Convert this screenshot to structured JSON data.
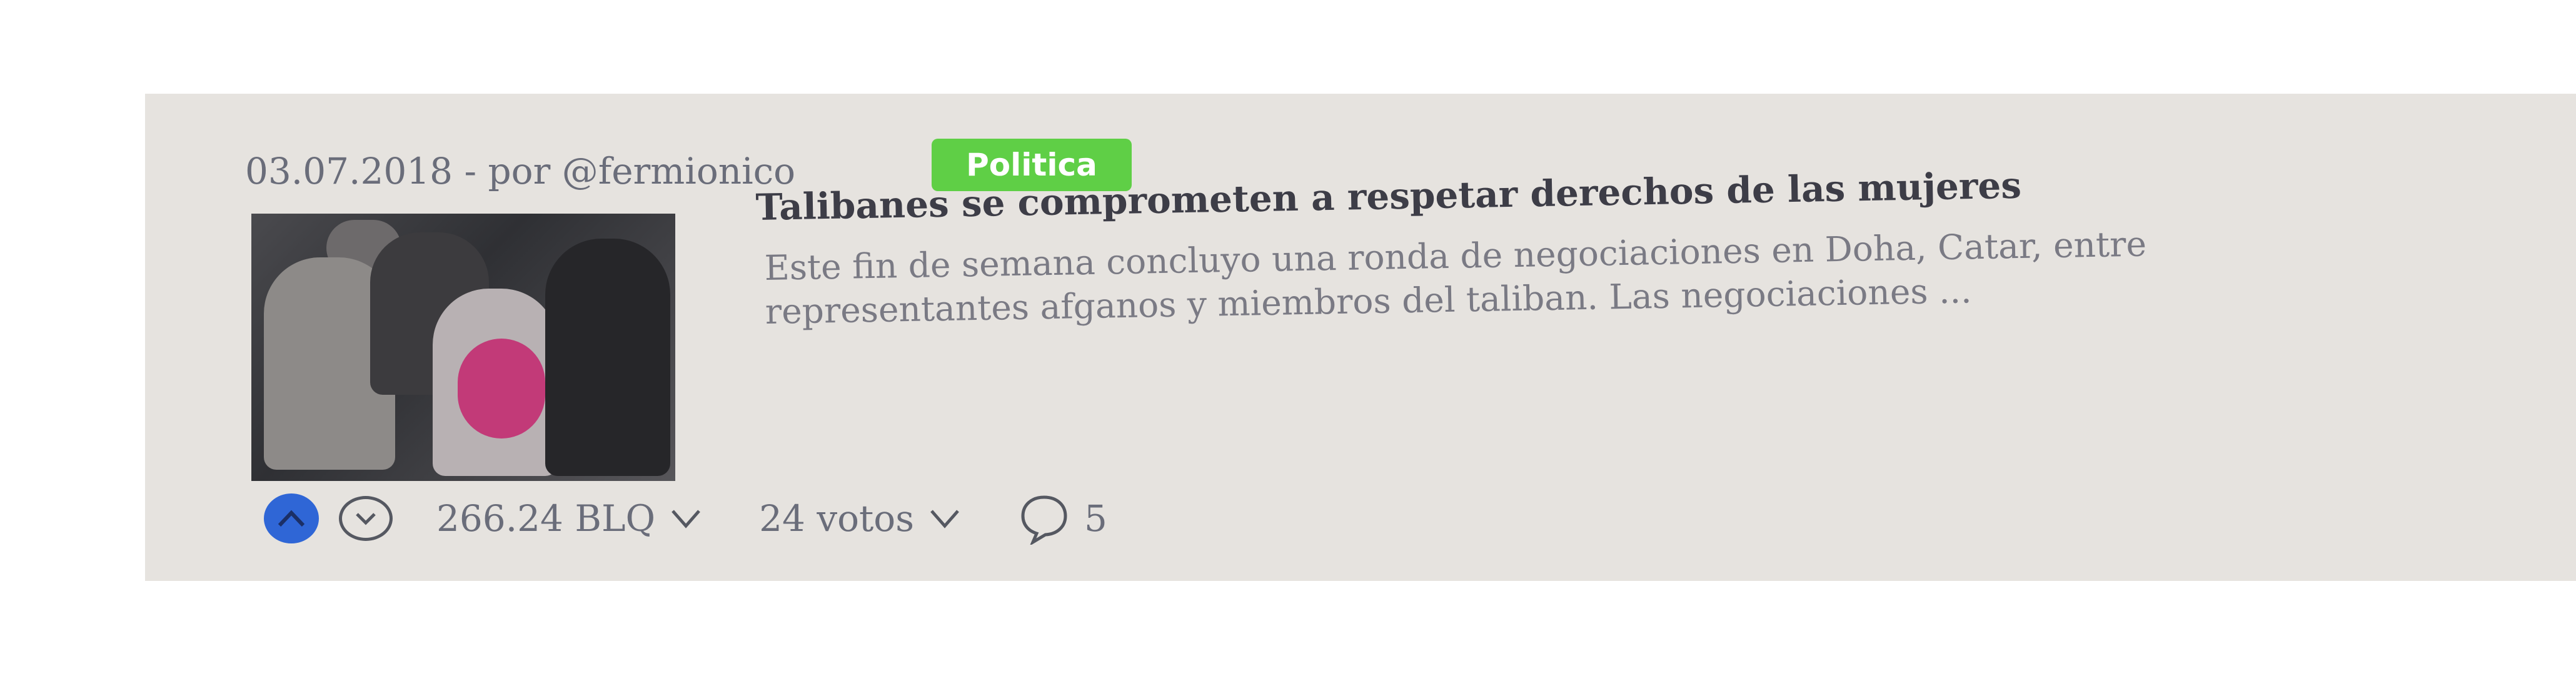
{
  "post": {
    "meta": "03.07.2018 - por @fermionico",
    "category": "Politica",
    "title": "Talibanes se comprometen a respetar derechos de las mujeres",
    "excerpt": "Este fin de semana concluyo una ronda de negociaciones en Doha, Catar, entre representantes afganos y miembros del taliban. Las negociaciones ...",
    "thumbnail_icon": "photo-women-gathering"
  },
  "actions": {
    "amount": "266.24 BLQ",
    "votes": "24 votos",
    "comments": "5"
  },
  "colors": {
    "card_bg": "#e6e3df",
    "tag_bg": "#5fcf46",
    "upvote": "#2f66d6"
  }
}
